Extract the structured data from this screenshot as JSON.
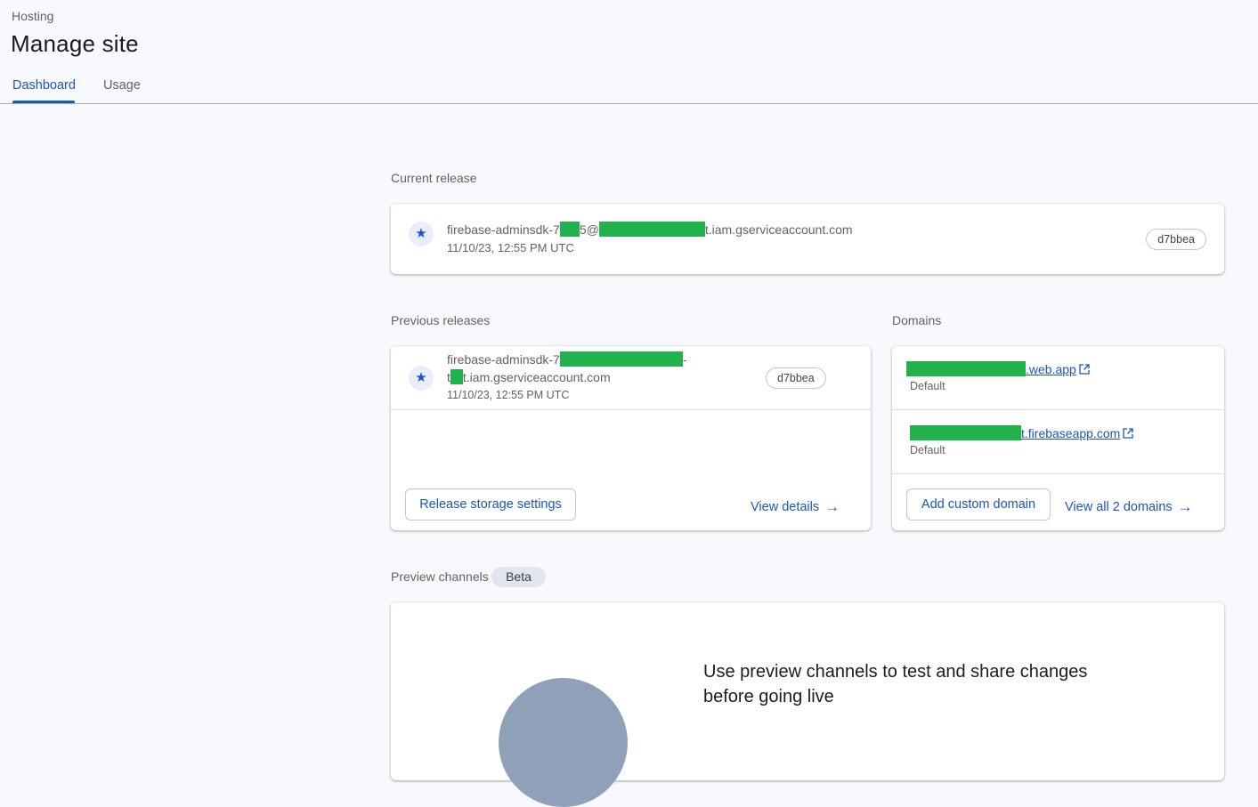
{
  "header": {
    "breadcrumb": "Hosting",
    "title": "Manage site",
    "tabs": [
      {
        "label": "Dashboard",
        "active": true
      },
      {
        "label": "Usage",
        "active": false
      }
    ]
  },
  "current_release": {
    "section_title": "Current release",
    "email_prefix": "firebase-adminsdk-7",
    "email_mid": "5@",
    "email_suffix": "t.iam.gserviceaccount.com",
    "date": "11/10/23, 12:55 PM UTC",
    "hash": "d7bbea",
    "icon": "star-icon"
  },
  "previous_releases": {
    "section_title": "Previous releases",
    "email_prefix": "firebase-adminsdk-7",
    "email_line1_end": "-",
    "email_line2_prefix": "t",
    "email_line2_suffix": "t.iam.gserviceaccount.com",
    "date": "11/10/23, 12:55 PM UTC",
    "hash": "d7bbea",
    "icon": "star-icon",
    "storage_button": "Release storage settings",
    "view_details": "View details"
  },
  "domains": {
    "section_title": "Domains",
    "items": [
      {
        "suffix": ".web.app",
        "sub": "Default"
      },
      {
        "suffix": "t.firebaseapp.com",
        "sub": "Default"
      }
    ],
    "add_button": "Add custom domain",
    "view_all": "View all 2 domains"
  },
  "preview_channels": {
    "section_title": "Preview channels",
    "badge": "Beta",
    "text": "Use preview channels to test and share changes before going live"
  },
  "colors": {
    "accent": "#1a56c0",
    "redaction": "#22b24c",
    "background": "#f8f9fc"
  }
}
